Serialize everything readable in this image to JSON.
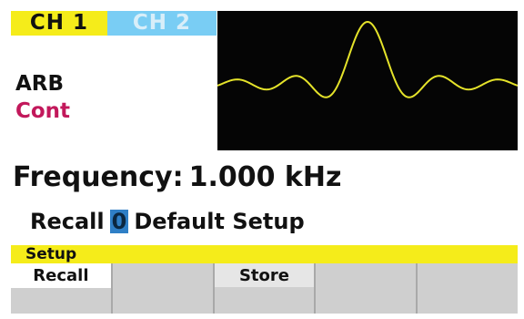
{
  "channels": {
    "ch1_label": "CH 1",
    "ch2_label": "CH 2"
  },
  "waveform": {
    "shape": "sinc",
    "trace_color": "#e5e32a"
  },
  "status": {
    "function": "ARB",
    "mode": "Cont"
  },
  "frequency": {
    "label": "Frequency:",
    "value": "1.000 kHz"
  },
  "recall": {
    "label": "Recall",
    "slot": "0",
    "name": "Default Setup"
  },
  "menu": {
    "title": "Setup",
    "softkeys": [
      {
        "label": "Recall",
        "active": true
      },
      {
        "label": ""
      },
      {
        "label": "Store"
      },
      {
        "label": ""
      },
      {
        "label": ""
      }
    ]
  },
  "colors": {
    "tab_active": "#f5ec1a",
    "tab_inactive": "#79cdf4",
    "cont_text": "#c2185b",
    "slot_highlight": "#2f7fc6"
  }
}
